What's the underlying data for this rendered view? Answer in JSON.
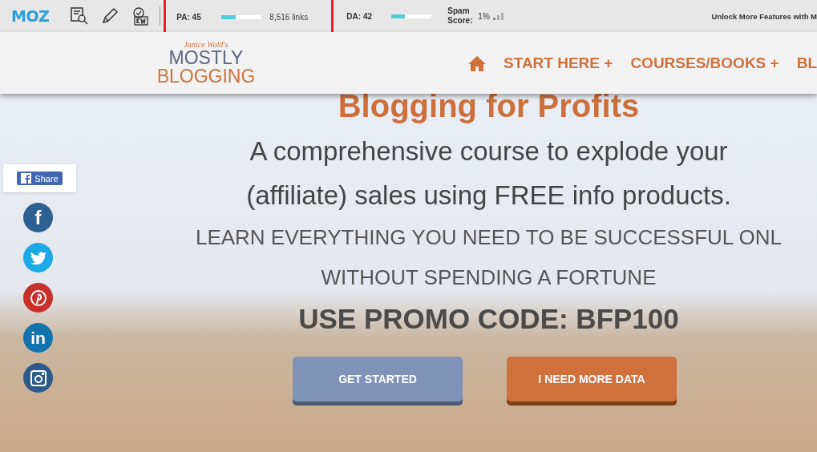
{
  "toolbar": {
    "logo": "MOZ",
    "metrics": [
      {
        "label": "PA: 45",
        "level": 0.35,
        "reading": "8,516 links",
        "highlighted": true
      },
      {
        "label": "DA: 42",
        "level": 0.33,
        "highlighted": false
      }
    ],
    "spam": {
      "label": "Spam Score:",
      "reading": "1%"
    },
    "promo": "Unlock More Features with M"
  },
  "header": {
    "logo": {
      "tagline": "Janice Wald's",
      "line_1": "MOSTLY",
      "line_2": "BLOGGING"
    },
    "nav": [
      "START HERE +",
      "COURSES/BOOKS +",
      "BL"
    ]
  },
  "share": {
    "label": "Share",
    "social": [
      {
        "kind": "facebook",
        "glyph": "f",
        "color": "#2d5f93"
      },
      {
        "kind": "twitter",
        "color": "#1da9e6"
      },
      {
        "kind": "pinterest",
        "color": "#c8312b"
      },
      {
        "kind": "linkedin",
        "glyph": "in",
        "color": "#1273ad"
      },
      {
        "kind": "instagram",
        "color": "#2e5a8a"
      }
    ]
  },
  "hero": {
    "title": "Blogging for Profits",
    "subtitle": [
      "A comprehensive course to explode your",
      "(affiliate) sales using FREE info products."
    ],
    "lead": [
      "LEARN EVERYTHING YOU NEED TO BE SUCCESSFUL ONL",
      "WITHOUT SPENDING A FORTUNE"
    ],
    "promo": "USE PROMO CODE: BFP100",
    "buttons": [
      {
        "label": "GET STARTED",
        "kind": "secondary"
      },
      {
        "label": "I NEED MORE DATA",
        "kind": "primary"
      }
    ]
  }
}
